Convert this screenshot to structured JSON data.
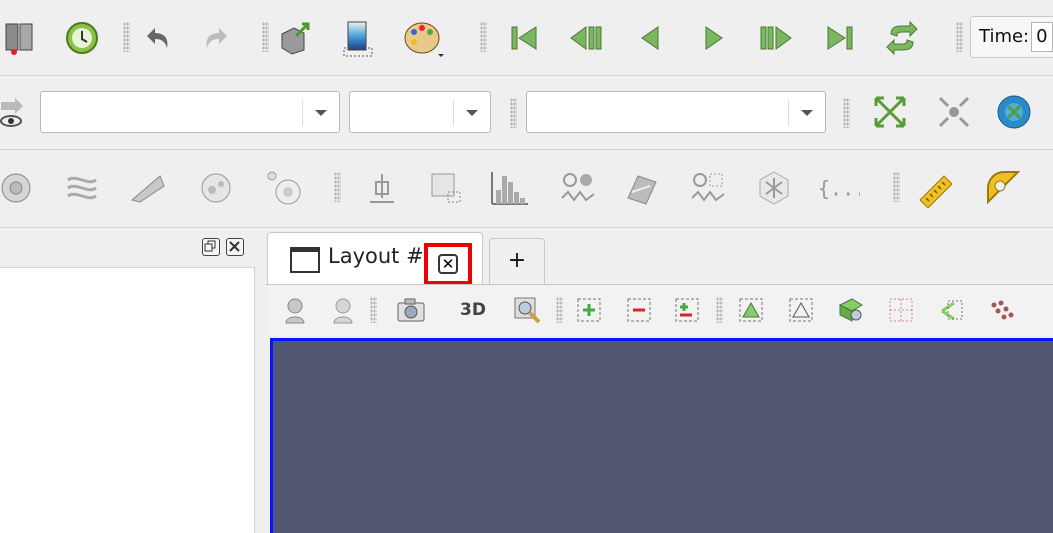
{
  "toolbar1": {
    "icons": [
      "connect-server-icon",
      "reset-session-icon",
      "undo-icon",
      "redo-icon",
      "reset-camera-icon",
      "color-legend-icon",
      "color-palette-icon",
      "first-frame-icon",
      "previous-frame-icon",
      "play-backward-icon",
      "play-icon",
      "next-frame-icon",
      "last-frame-icon",
      "loop-icon"
    ],
    "time_label": "Time:",
    "time_value": "0"
  },
  "toolbar2": {
    "combos": [
      {
        "name": "representation-combo",
        "value": ""
      },
      {
        "name": "color-array-combo",
        "value": ""
      },
      {
        "name": "color-component-combo",
        "value": ""
      }
    ],
    "icons": [
      "toggle-visibility-icon",
      "zoom-to-data-icon",
      "zoom-closest-icon",
      "orientation-axes-icon"
    ]
  },
  "toolbar3": {
    "icons": [
      "calculator-filter-icon",
      "contour-filter-icon",
      "clip-filter-icon",
      "slice-filter-icon",
      "threshold-filter-icon",
      "extract-subset-icon",
      "glyph-filter-icon",
      "histogram-icon",
      "plot-over-time-icon",
      "warp-filter-icon",
      "plot-selection-icon",
      "group-datasets-icon",
      "python-calculator-icon",
      "ruler-icon",
      "protractor-icon"
    ]
  },
  "left_dock": {
    "float_label": "⧉",
    "close_label": "✕"
  },
  "tabs": {
    "layout_label": "Layout #1",
    "close_label": "✕",
    "add_label": "+"
  },
  "view_toolbar": {
    "three_d_label": "3D",
    "icons": [
      "reset-camera-view-icon",
      "interact-view-icon",
      "capture-screenshot-icon",
      "three-d-toggle",
      "zoom-to-box-icon",
      "select-points-on-icon",
      "select-cells-on-icon",
      "select-block-icon",
      "select-points-through-icon",
      "select-cells-through-icon",
      "select-polygon-icon",
      "interactive-select-icon",
      "hover-points-icon",
      "hover-cells-icon",
      "grow-selection-icon"
    ]
  },
  "colors": {
    "render_background": "#525670",
    "active_view_border": "#0a14ff",
    "highlight": "#ee0000",
    "play_green": "#7bb661"
  }
}
